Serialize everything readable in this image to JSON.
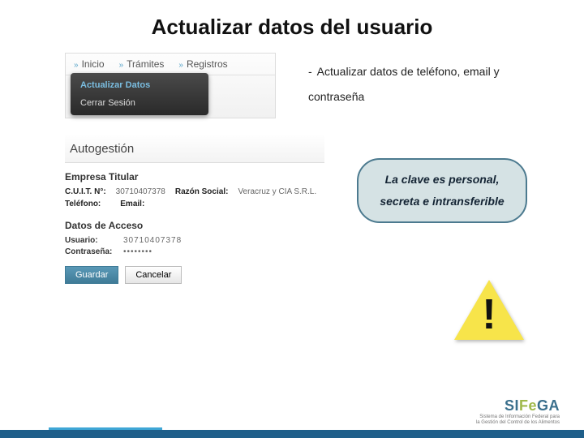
{
  "title": "Actualizar datos del usuario",
  "nav": {
    "items": [
      "Inicio",
      "Trámites",
      "Registros"
    ],
    "dropdown": {
      "active": "Actualizar Datos",
      "other": "Cerrar Sesión"
    }
  },
  "description": {
    "line1": "Actualizar datos de teléfono, email y",
    "line2": "contraseña"
  },
  "panel": {
    "heading": "Autogestión",
    "section_empresa": "Empresa Titular",
    "cuit_label": "C.U.I.T. N°:",
    "cuit_value": "30710407378",
    "razon_label": "Razón Social:",
    "razon_value": "Veracruz y CIA S.R.L.",
    "telefono_label": "Teléfono:",
    "telefono_value": "",
    "email_label": "Email:",
    "email_value": "",
    "section_acceso": "Datos de Acceso",
    "usuario_label": "Usuario:",
    "usuario_value": "30710407378",
    "contrasena_label": "Contraseña:",
    "contrasena_value": "••••••••",
    "btn_guardar": "Guardar",
    "btn_cancelar": "Cancelar"
  },
  "callout": {
    "line1": "La clave es personal,",
    "line2": "secreta e intransferible"
  },
  "warning": {
    "glyph": "!"
  },
  "logo": {
    "brand_prefix": "SI",
    "brand_mid": "Fe",
    "brand_suffix": "GA",
    "subtitle1": "Sistema de Información Federal para",
    "subtitle2": "la Gestión del Control de los Alimentos"
  }
}
